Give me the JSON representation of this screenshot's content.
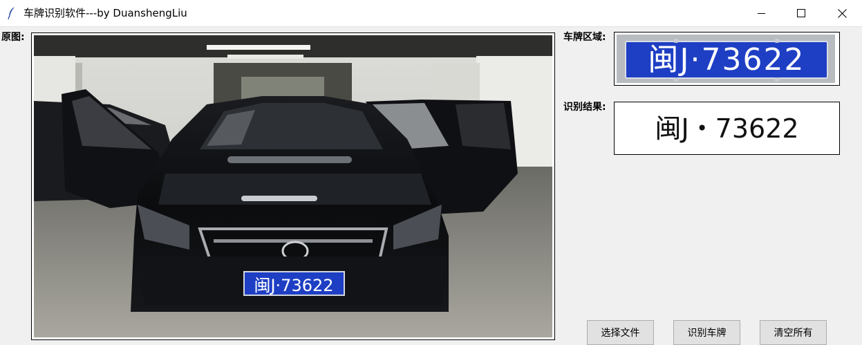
{
  "window": {
    "title": "车牌识别软件---by DuanshengLiu",
    "icon": "feather-icon",
    "controls": [
      "minimize-icon",
      "maximize-icon",
      "close-icon"
    ]
  },
  "labels": {
    "original": "原图:",
    "plate_region": "车牌区域:",
    "result": "识别结果:"
  },
  "plate_image_text": "闽J·73622",
  "photo_plate_text": "闽J·73622",
  "result_text": "闽J・73622",
  "buttons": {
    "select_file": "选择文件",
    "recognize": "识别车牌",
    "clear_all": "清空所有"
  },
  "colors": {
    "plate_blue": "#1e3fc4",
    "window_bg": "#f0f0f0"
  }
}
